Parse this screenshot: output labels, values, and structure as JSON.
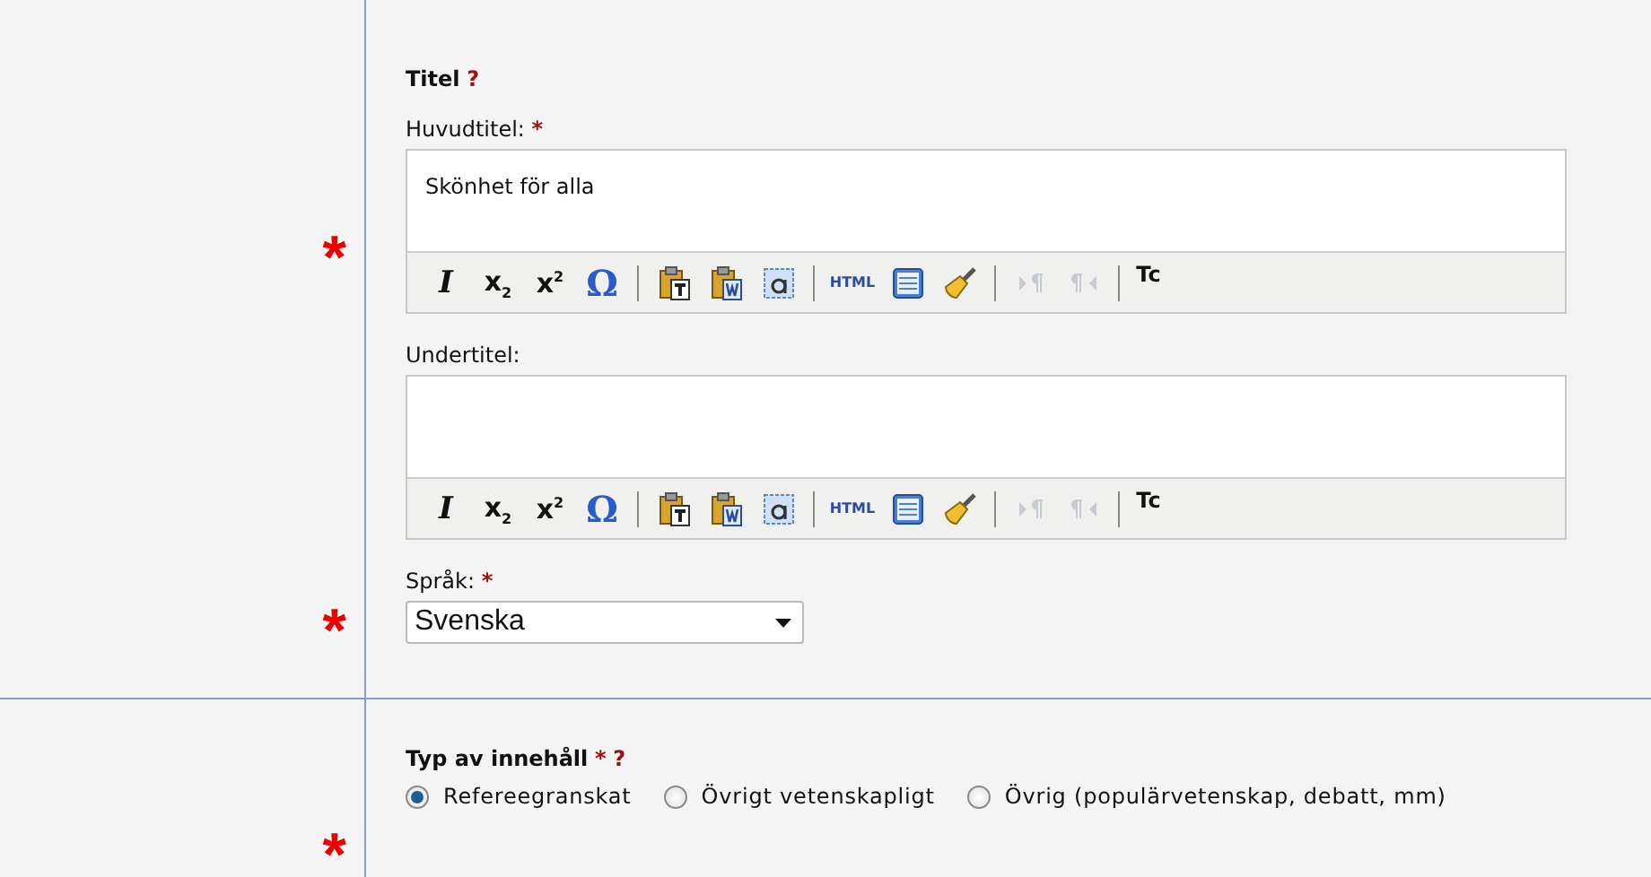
{
  "titel_section": {
    "heading": "Titel",
    "help": "?",
    "fields": [
      {
        "kind": "editor",
        "label": "Huvudtitel:",
        "required_mark": "*",
        "gutter_mark": "*",
        "value": "Skönhet för alla",
        "toolbar": [
          {
            "kind": "italic",
            "label": "I",
            "disabled": false
          },
          {
            "kind": "sub",
            "label": "x$_{2}$",
            "disabled": false
          },
          {
            "kind": "sup",
            "label": "x$^{2}$",
            "disabled": false
          },
          {
            "kind": "omega",
            "label": "Ω",
            "disabled": false
          },
          {
            "kind": "sep"
          },
          {
            "kind": "paste-text",
            "disabled": false
          },
          {
            "kind": "paste-word",
            "disabled": false
          },
          {
            "kind": "select-all",
            "disabled": false
          },
          {
            "kind": "sep"
          },
          {
            "kind": "html",
            "label": "HTML",
            "disabled": false
          },
          {
            "kind": "template",
            "disabled": false
          },
          {
            "kind": "cleanup",
            "disabled": false
          },
          {
            "kind": "sep"
          },
          {
            "kind": "ltr",
            "disabled": true
          },
          {
            "kind": "rtl",
            "disabled": true
          },
          {
            "kind": "sep"
          },
          {
            "kind": "tc",
            "label": "Tc",
            "disabled": false
          }
        ]
      },
      {
        "kind": "editor",
        "label": "Undertitel:",
        "toolbar": [
          {
            "kind": "italic",
            "label": "I",
            "disabled": false
          },
          {
            "kind": "sub",
            "label": "x$_{2}$",
            "disabled": false
          },
          {
            "kind": "sup",
            "label": "x$^{2}$",
            "disabled": false
          },
          {
            "kind": "omega",
            "label": "Ω",
            "disabled": false
          },
          {
            "kind": "sep"
          },
          {
            "kind": "paste-text",
            "disabled": false
          },
          {
            "kind": "paste-word",
            "disabled": false
          },
          {
            "kind": "select-all",
            "disabled": false
          },
          {
            "kind": "sep"
          },
          {
            "kind": "html",
            "label": "HTML",
            "disabled": false
          },
          {
            "kind": "template",
            "disabled": false
          },
          {
            "kind": "cleanup",
            "disabled": false
          },
          {
            "kind": "sep"
          },
          {
            "kind": "ltr",
            "disabled": true
          },
          {
            "kind": "rtl",
            "disabled": true
          },
          {
            "kind": "sep"
          },
          {
            "kind": "tc",
            "label": "Tc",
            "disabled": false
          }
        ]
      },
      {
        "kind": "select",
        "label": "Språk:",
        "required_mark": "*",
        "gutter_mark": "*",
        "value": "Svenska"
      }
    ]
  },
  "content_type": {
    "heading": "Typ av innehåll",
    "required_mark": "*",
    "help": "?",
    "gutter_mark": "*",
    "options": [
      {
        "label": "Refereegranskat",
        "selected": true
      },
      {
        "label": "Övrigt vetenskapligt",
        "selected": false
      },
      {
        "label": "Övrig (populärvetenskap, debatt, mm)",
        "selected": false
      }
    ]
  }
}
